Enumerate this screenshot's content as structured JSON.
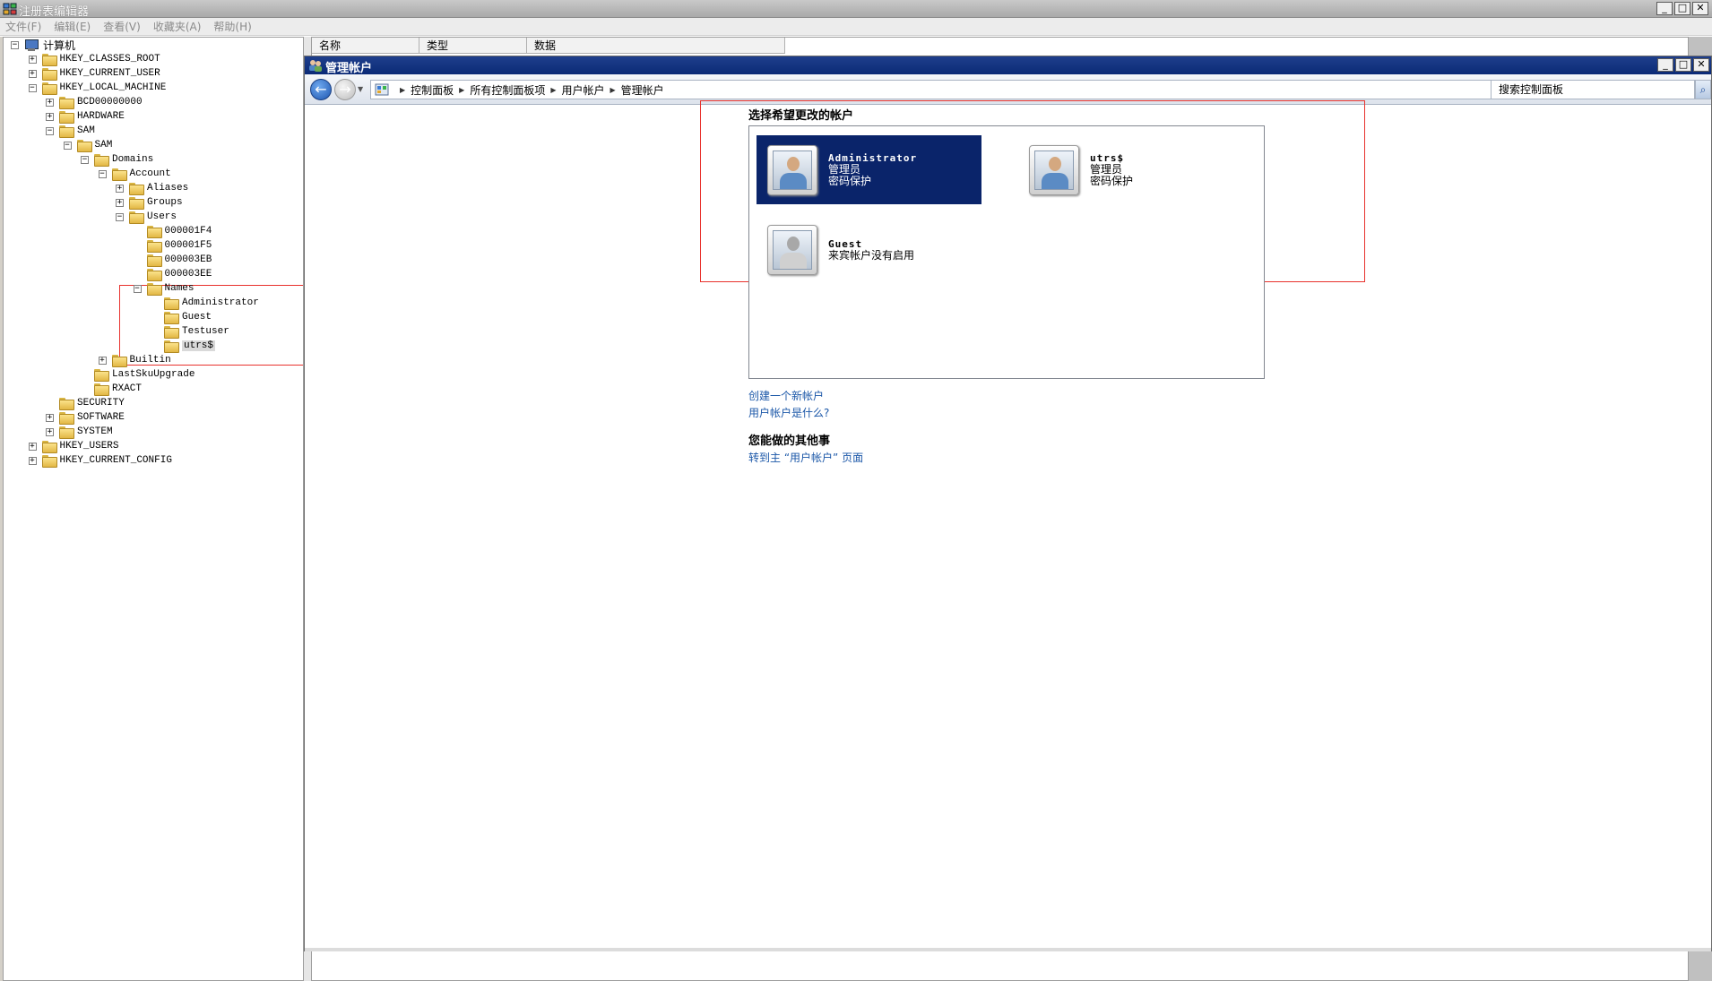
{
  "registry_editor": {
    "title": "注册表编辑器",
    "menu": [
      "文件(F)",
      "编辑(E)",
      "查看(V)",
      "收藏夹(A)",
      "帮助(H)"
    ],
    "columns": [
      "名称",
      "类型",
      "数据"
    ],
    "tree": [
      {
        "label": "计算机",
        "expander": "−",
        "icon": "computer-icon",
        "cn": true
      },
      {
        "label": "HKEY_CLASSES_ROOT",
        "expander": "+"
      },
      {
        "label": "HKEY_CURRENT_USER",
        "expander": "+"
      },
      {
        "label": "HKEY_LOCAL_MACHINE",
        "expander": "−"
      },
      {
        "label": "BCD00000000",
        "expander": "+"
      },
      {
        "label": "HARDWARE",
        "expander": "+"
      },
      {
        "label": "SAM",
        "expander": "−"
      },
      {
        "label": "SAM",
        "expander": "−"
      },
      {
        "label": "Domains",
        "expander": "−"
      },
      {
        "label": "Account",
        "expander": "−"
      },
      {
        "label": "Aliases",
        "expander": "+"
      },
      {
        "label": "Groups",
        "expander": "+"
      },
      {
        "label": "Users",
        "expander": "−"
      },
      {
        "label": "000001F4",
        "expander": ""
      },
      {
        "label": "000001F5",
        "expander": ""
      },
      {
        "label": "000003EB",
        "expander": ""
      },
      {
        "label": "000003EE",
        "expander": ""
      },
      {
        "label": "Names",
        "expander": "−"
      },
      {
        "label": "Administrator",
        "expander": ""
      },
      {
        "label": "Guest",
        "expander": ""
      },
      {
        "label": "Testuser",
        "expander": ""
      },
      {
        "label": "utrs$",
        "expander": "",
        "selected": true
      },
      {
        "label": "Builtin",
        "expander": "+"
      },
      {
        "label": "LastSkuUpgrade",
        "expander": ""
      },
      {
        "label": "RXACT",
        "expander": ""
      },
      {
        "label": "SECURITY",
        "expander": ""
      },
      {
        "label": "SOFTWARE",
        "expander": "+"
      },
      {
        "label": "SYSTEM",
        "expander": "+"
      },
      {
        "label": "HKEY_USERS",
        "expander": "+"
      },
      {
        "label": "HKEY_CURRENT_CONFIG",
        "expander": "+"
      }
    ]
  },
  "control_panel": {
    "title": "管理帐户",
    "breadcrumbs": [
      "控制面板",
      "所有控制面板项",
      "用户帐户",
      "管理帐户"
    ],
    "search_placeholder": "搜索控制面板",
    "heading": "选择希望更改的帐户",
    "accounts": [
      {
        "name": "Administrator",
        "lines": [
          "管理员",
          "密码保护"
        ],
        "selected": true,
        "icon": "user-avatar-icon"
      },
      {
        "name": "utrs$",
        "lines": [
          "管理员",
          "密码保护"
        ],
        "selected": false,
        "icon": "user-avatar-icon"
      },
      {
        "name": "Guest",
        "lines": [
          "来宾帐户没有启用"
        ],
        "selected": false,
        "icon": "guest-avatar-icon"
      }
    ],
    "links": {
      "create_account": "创建一个新帐户",
      "what_is_account": "用户帐户是什么?"
    },
    "other_heading": "您能做的其他事",
    "other_links": {
      "go_main": "转到主 “用户帐户” 页面"
    }
  },
  "colors": {
    "selected_account_bg": "#0a246a",
    "highlight_box": "#e8322d",
    "link": "#1b57a8"
  }
}
